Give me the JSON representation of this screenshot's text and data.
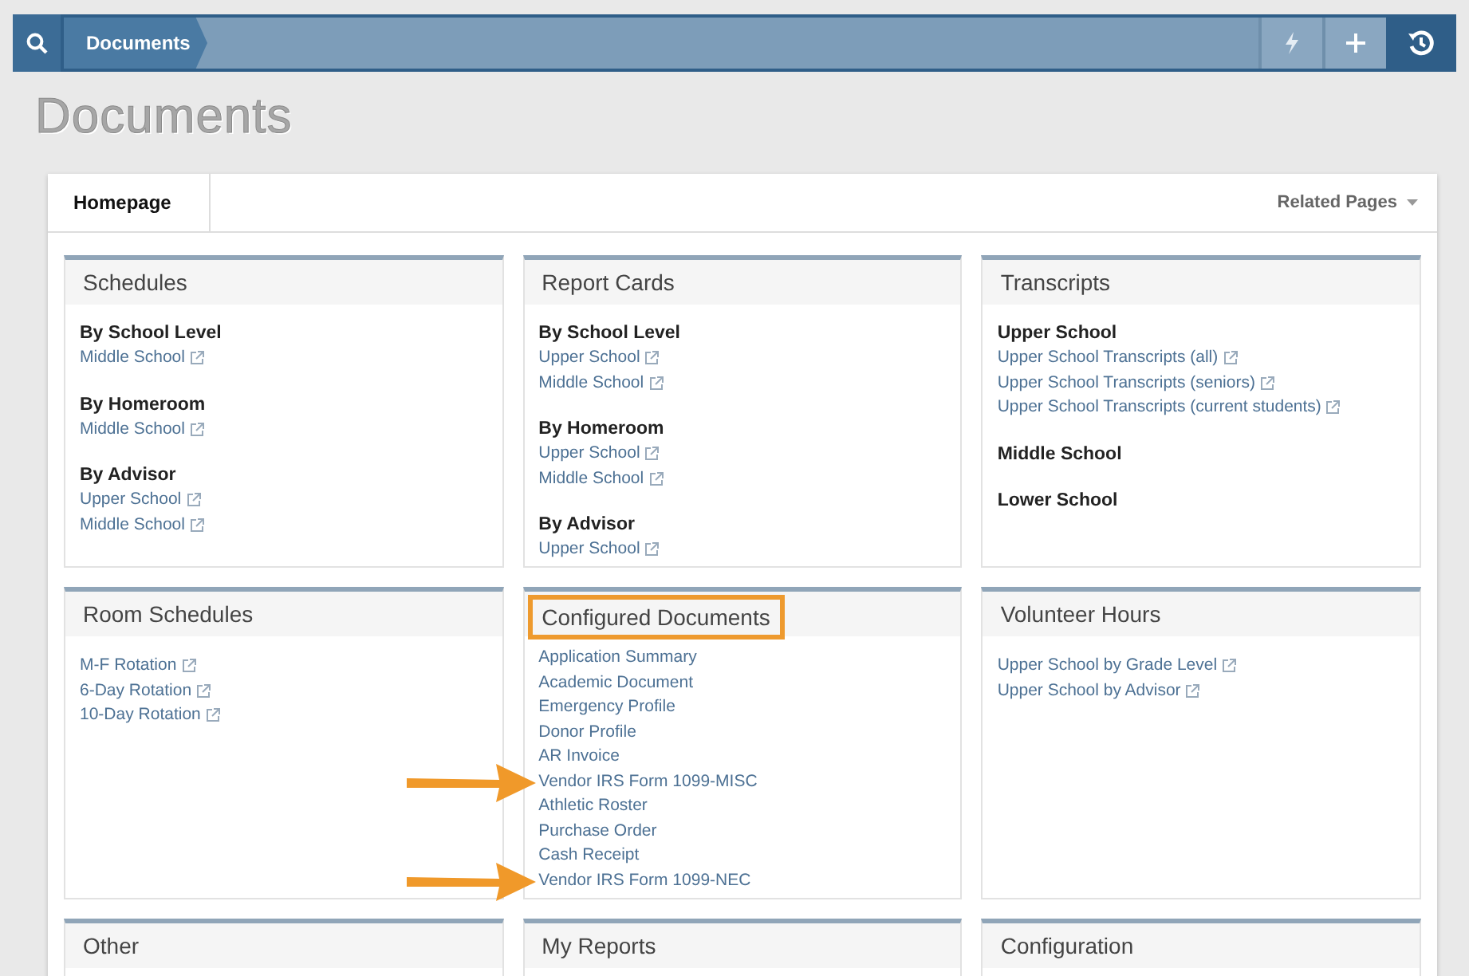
{
  "topbar": {
    "breadcrumb": "Documents"
  },
  "page_title": "Documents",
  "tabs": [
    {
      "label": "Homepage",
      "selected": true
    }
  ],
  "related_pages": "Related Pages",
  "cards": [
    {
      "title": "Schedules",
      "highlighted": false,
      "groups": [
        {
          "heading": "By School Level",
          "links": [
            {
              "text": "Middle School",
              "external": true
            }
          ]
        },
        {
          "heading": "By Homeroom",
          "links": [
            {
              "text": "Middle School",
              "external": true
            }
          ]
        },
        {
          "heading": "By Advisor",
          "links": [
            {
              "text": "Upper School",
              "external": true
            },
            {
              "text": "Middle School",
              "external": true
            }
          ]
        }
      ]
    },
    {
      "title": "Report Cards",
      "highlighted": false,
      "groups": [
        {
          "heading": "By School Level",
          "links": [
            {
              "text": "Upper School",
              "external": true
            },
            {
              "text": "Middle School",
              "external": true
            }
          ]
        },
        {
          "heading": "By Homeroom",
          "links": [
            {
              "text": "Upper School",
              "external": true
            },
            {
              "text": "Middle School",
              "external": true
            }
          ]
        },
        {
          "heading": "By Advisor",
          "links": [
            {
              "text": "Upper School",
              "external": true
            }
          ]
        }
      ]
    },
    {
      "title": "Transcripts",
      "highlighted": false,
      "groups": [
        {
          "heading": "Upper School",
          "links": [
            {
              "text": "Upper School Transcripts (all)",
              "external": true
            },
            {
              "text": "Upper School Transcripts (seniors)",
              "external": true
            },
            {
              "text": "Upper School Transcripts (current students)",
              "external": true
            }
          ]
        },
        {
          "heading": "Middle School"
        },
        {
          "heading": "Lower School"
        }
      ]
    },
    {
      "title": "Room Schedules",
      "highlighted": false,
      "groups": [
        {
          "links": [
            {
              "text": "M-F Rotation",
              "external": true
            },
            {
              "text": "6-Day Rotation",
              "external": true
            },
            {
              "text": "10-Day Rotation",
              "external": true
            }
          ]
        }
      ]
    },
    {
      "title": "Configured Documents",
      "highlighted": true,
      "groups": [
        {
          "links": [
            {
              "text": "Application Summary",
              "external": false,
              "arrow": false
            },
            {
              "text": "Academic Document",
              "external": false,
              "arrow": false
            },
            {
              "text": "Emergency Profile",
              "external": false,
              "arrow": false
            },
            {
              "text": "Donor Profile",
              "external": false,
              "arrow": false
            },
            {
              "text": "AR Invoice",
              "external": false,
              "arrow": false
            },
            {
              "text": "Vendor IRS Form 1099-MISC",
              "external": false,
              "arrow": true
            },
            {
              "text": "Athletic Roster",
              "external": false,
              "arrow": false
            },
            {
              "text": "Purchase Order",
              "external": false,
              "arrow": false
            },
            {
              "text": "Cash Receipt",
              "external": false,
              "arrow": false
            },
            {
              "text": "Vendor IRS Form 1099-NEC",
              "external": false,
              "arrow": true
            }
          ]
        }
      ]
    },
    {
      "title": "Volunteer Hours",
      "highlighted": false,
      "groups": [
        {
          "links": [
            {
              "text": "Upper School by Grade Level",
              "external": true
            },
            {
              "text": "Upper School by Advisor",
              "external": true
            }
          ]
        }
      ]
    },
    {
      "title": "Other",
      "highlighted": false
    },
    {
      "title": "My Reports",
      "highlighted": false
    },
    {
      "title": "Configuration",
      "highlighted": false
    }
  ]
}
